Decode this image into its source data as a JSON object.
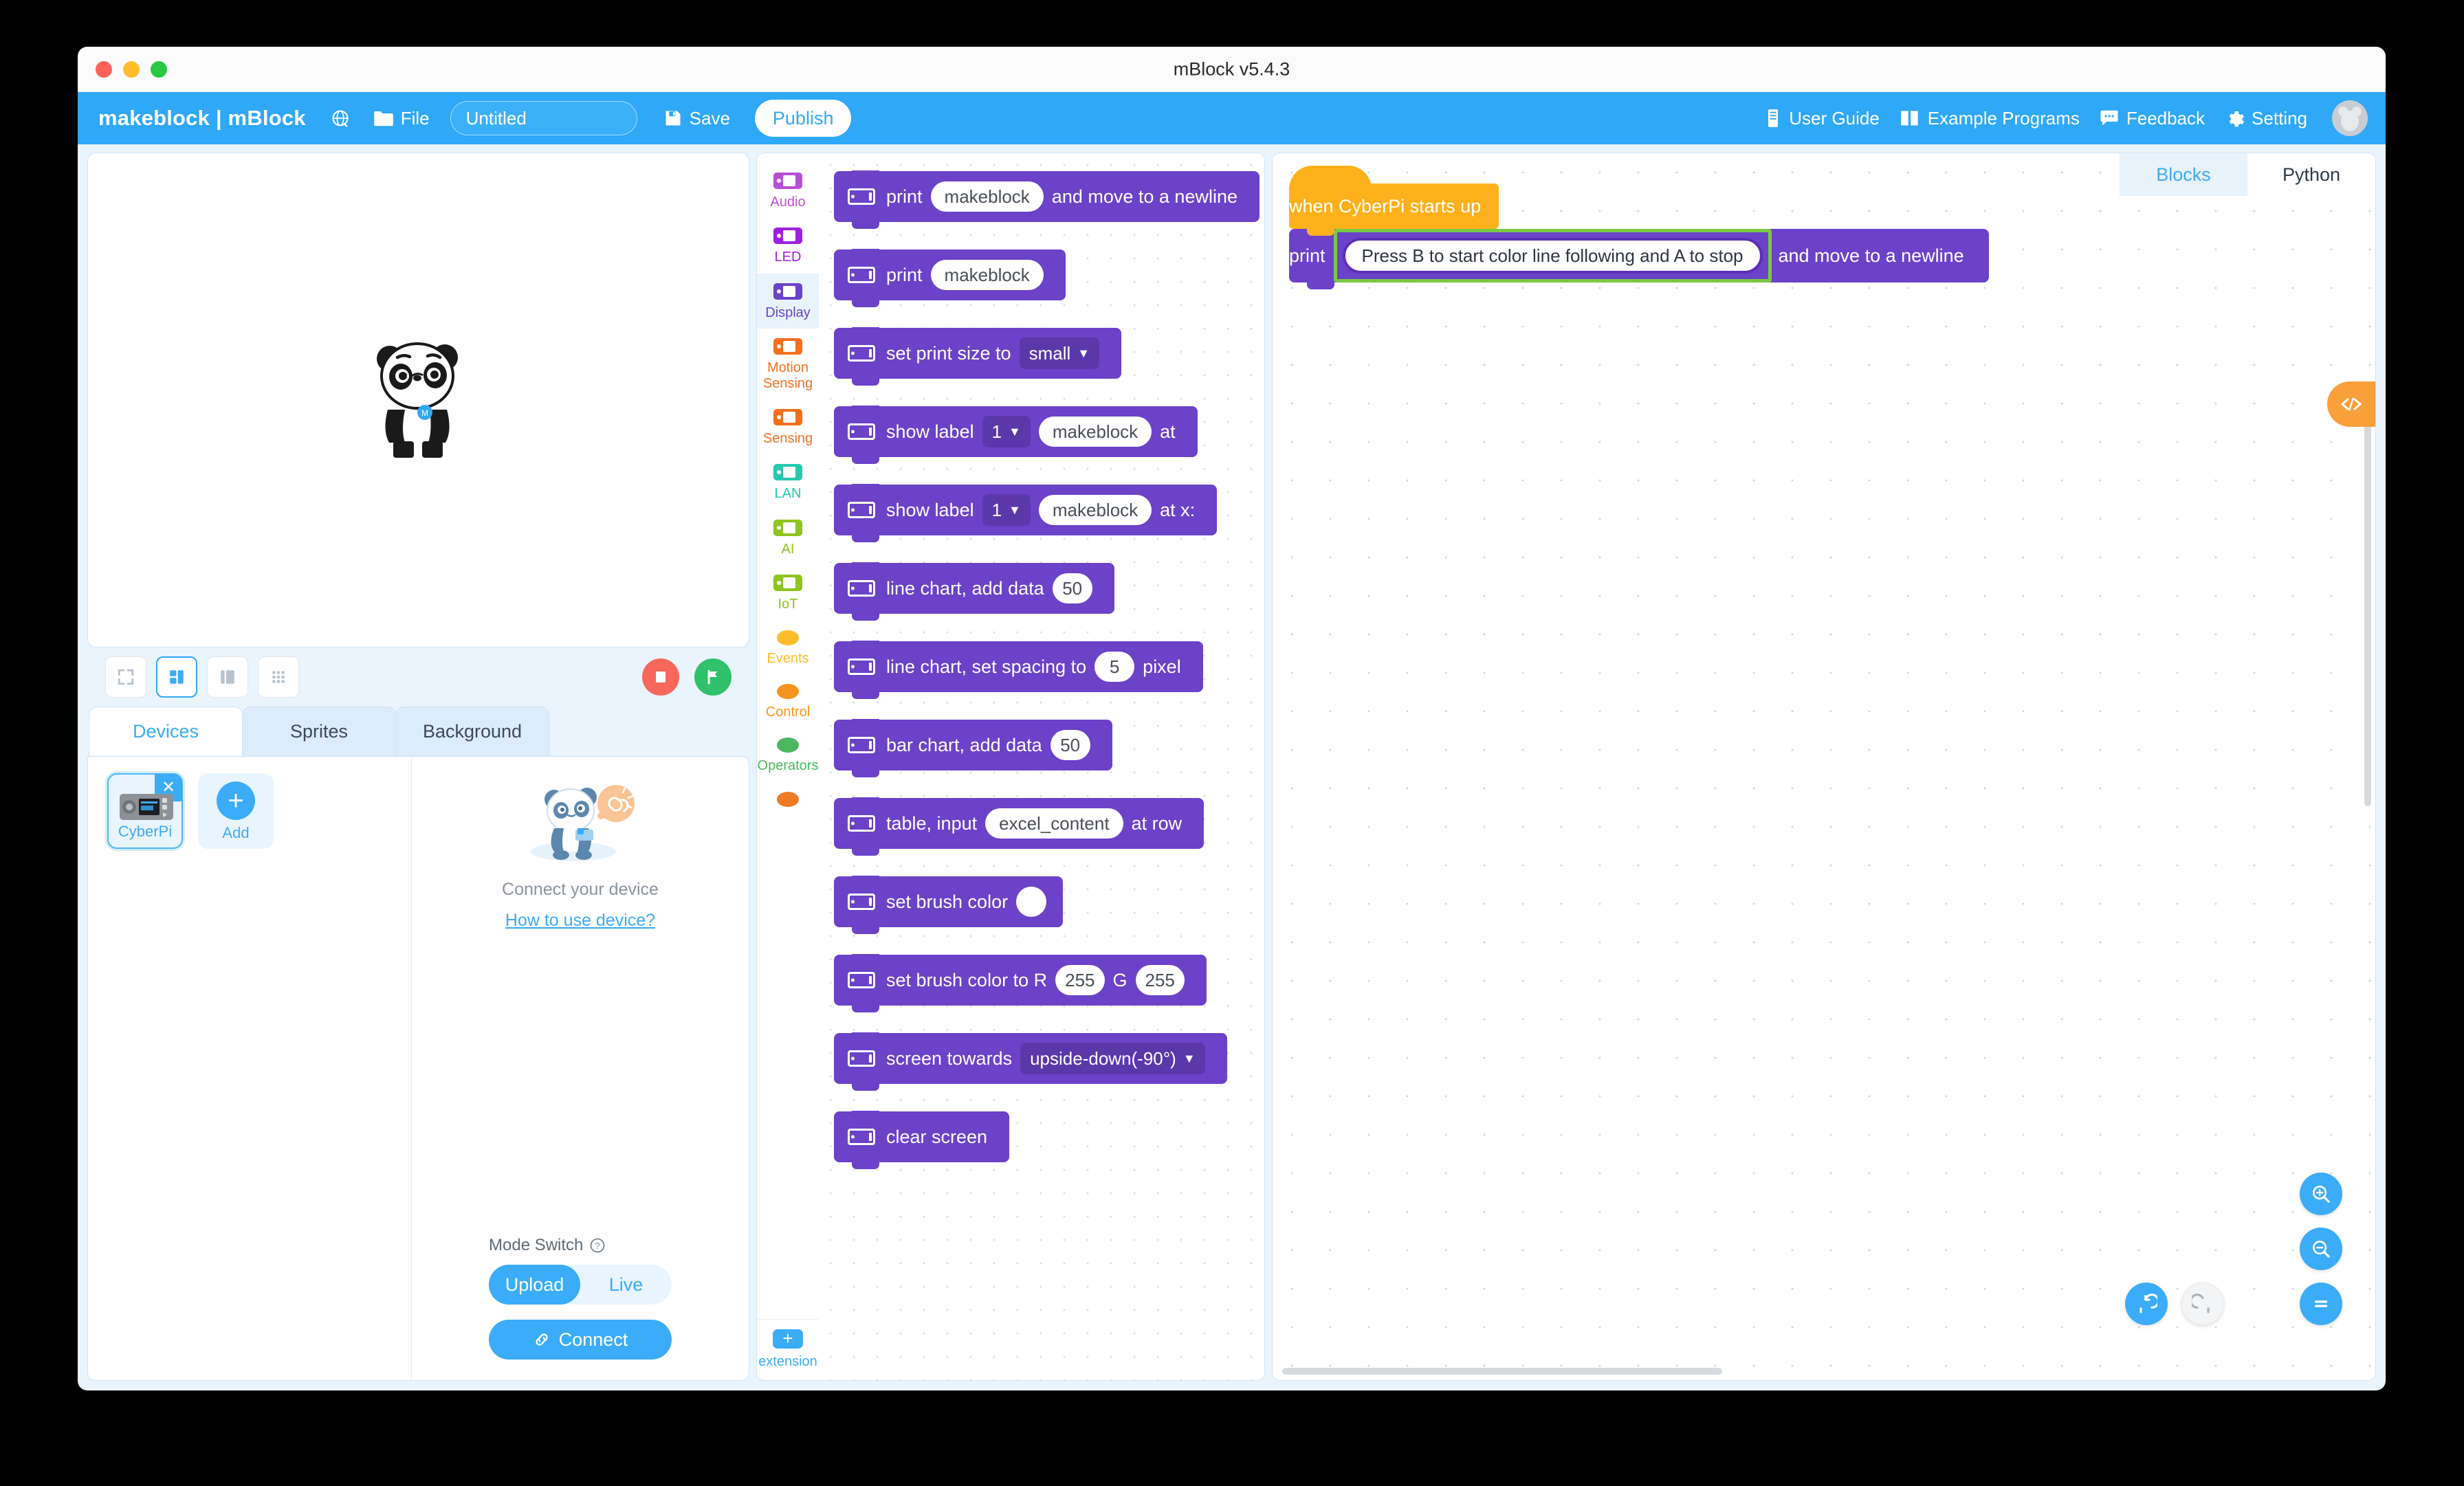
{
  "window": {
    "title": "mBlock v5.4.3"
  },
  "toolbar": {
    "brand": "makeblock | mBlock",
    "globe_label": "",
    "file_label": "File",
    "project_name": "Untitled",
    "project_placeholder": "Untitled",
    "save_label": "Save",
    "publish_label": "Publish",
    "right_items": [
      {
        "label": "User Guide",
        "icon": "book-icon"
      },
      {
        "label": "Example Programs",
        "icon": "open-book-icon"
      },
      {
        "label": "Feedback",
        "icon": "chat-icon"
      },
      {
        "label": "Setting",
        "icon": "gear-icon"
      }
    ]
  },
  "stage": {
    "sprite_name": "panda",
    "layout_buttons": [
      "fullscreen-layout",
      "split-layout",
      "wide-layout",
      "grid-layout"
    ],
    "active_layout_index": 1,
    "stop_label": "stop",
    "flag_label": "start"
  },
  "panel": {
    "tabs": [
      {
        "label": "Devices",
        "active": true
      },
      {
        "label": "Sprites",
        "active": false
      },
      {
        "label": "Background",
        "active": false
      }
    ],
    "devices": [
      {
        "label": "CyberPi",
        "selected": true
      },
      {
        "label": "Add",
        "selected": false
      }
    ],
    "connect": {
      "title": "Connect your device",
      "help_link": "How to use device?",
      "mode_label": "Mode Switch",
      "modes": [
        {
          "label": "Upload",
          "active": true
        },
        {
          "label": "Live",
          "active": false
        }
      ],
      "connect_button": "Connect"
    }
  },
  "palette": {
    "categories": [
      {
        "label": "Audio",
        "color": "#b94fd8",
        "shape": "board",
        "active": false
      },
      {
        "label": "LED",
        "color": "#a020e0",
        "shape": "board",
        "active": false
      },
      {
        "label": "Display",
        "color": "#6b42c8",
        "shape": "board",
        "active": true
      },
      {
        "label": "Motion\nSensing",
        "color": "#f5701e",
        "shape": "board",
        "active": false
      },
      {
        "label": "Sensing",
        "color": "#f5701e",
        "shape": "board",
        "active": false
      },
      {
        "label": "LAN",
        "color": "#27c8b0",
        "shape": "board",
        "active": false
      },
      {
        "label": "AI",
        "color": "#8fc31f",
        "shape": "board",
        "active": false
      },
      {
        "label": "IoT",
        "color": "#8fc31f",
        "shape": "board",
        "active": false
      },
      {
        "label": "Events",
        "color": "#ffbc2b",
        "shape": "dot",
        "active": false
      },
      {
        "label": "Control",
        "color": "#f5951e",
        "shape": "dot",
        "active": false
      },
      {
        "label": "Operators",
        "color": "#4bb860",
        "shape": "dot",
        "active": false
      },
      {
        "label": "",
        "color": "#f07b22",
        "shape": "dot",
        "active": false
      }
    ],
    "extension_label": "extension",
    "blocks": [
      {
        "parts": [
          {
            "t": "text",
            "v": "print"
          },
          {
            "t": "input",
            "v": "makeblock"
          },
          {
            "t": "text",
            "v": "and move to a newline"
          }
        ]
      },
      {
        "parts": [
          {
            "t": "text",
            "v": "print"
          },
          {
            "t": "input",
            "v": "makeblock"
          }
        ]
      },
      {
        "parts": [
          {
            "t": "text",
            "v": "set print size to"
          },
          {
            "t": "dropdown",
            "v": "small"
          }
        ]
      },
      {
        "parts": [
          {
            "t": "text",
            "v": "show label"
          },
          {
            "t": "dropdown",
            "v": "1"
          },
          {
            "t": "input",
            "v": "makeblock"
          },
          {
            "t": "text",
            "v": "at"
          }
        ]
      },
      {
        "parts": [
          {
            "t": "text",
            "v": "show label"
          },
          {
            "t": "dropdown",
            "v": "1"
          },
          {
            "t": "input",
            "v": "makeblock"
          },
          {
            "t": "text",
            "v": "at x:"
          }
        ]
      },
      {
        "parts": [
          {
            "t": "text",
            "v": "line chart, add data"
          },
          {
            "t": "num",
            "v": "50"
          }
        ]
      },
      {
        "parts": [
          {
            "t": "text",
            "v": "line chart, set spacing to"
          },
          {
            "t": "num",
            "v": "5"
          },
          {
            "t": "text",
            "v": "pixel"
          }
        ]
      },
      {
        "parts": [
          {
            "t": "text",
            "v": "bar chart, add data"
          },
          {
            "t": "num",
            "v": "50"
          }
        ]
      },
      {
        "parts": [
          {
            "t": "text",
            "v": "table, input"
          },
          {
            "t": "input",
            "v": "excel_content"
          },
          {
            "t": "text",
            "v": "at row"
          }
        ]
      },
      {
        "parts": [
          {
            "t": "text",
            "v": "set brush color"
          },
          {
            "t": "swatch",
            "v": "#ffffff"
          }
        ]
      },
      {
        "parts": [
          {
            "t": "text",
            "v": "set brush color to R"
          },
          {
            "t": "num",
            "v": "255"
          },
          {
            "t": "text",
            "v": "G"
          },
          {
            "t": "num",
            "v": "255"
          }
        ]
      },
      {
        "parts": [
          {
            "t": "text",
            "v": "screen towards"
          },
          {
            "t": "dropdown",
            "v": "upside-down(-90°)"
          }
        ]
      },
      {
        "parts": [
          {
            "t": "text",
            "v": "clear screen"
          }
        ]
      }
    ]
  },
  "script": {
    "mode_tabs": [
      {
        "label": "Blocks",
        "active": true
      },
      {
        "label": "Python",
        "active": false
      }
    ],
    "hat_block": "when CyberPi starts up",
    "print_block": {
      "prefix": "print",
      "editing_value": "Press B to start color line following and A to stop",
      "suffix": "and move to a newline"
    },
    "code_toggle_label": "</>",
    "fabs": [
      {
        "name": "zoom-in-button",
        "glyph": "+"
      },
      {
        "name": "zoom-out-button",
        "glyph": "−"
      },
      {
        "name": "zoom-reset-button",
        "glyph": "="
      },
      {
        "name": "undo-button",
        "glyph": "↺"
      },
      {
        "name": "redo-button",
        "glyph": "↻"
      }
    ]
  },
  "colors": {
    "accent": "#2fa8f7",
    "display_block": "#6b42c8",
    "event_block": "#ffb11b",
    "edit_highlight": "#7ac943"
  }
}
